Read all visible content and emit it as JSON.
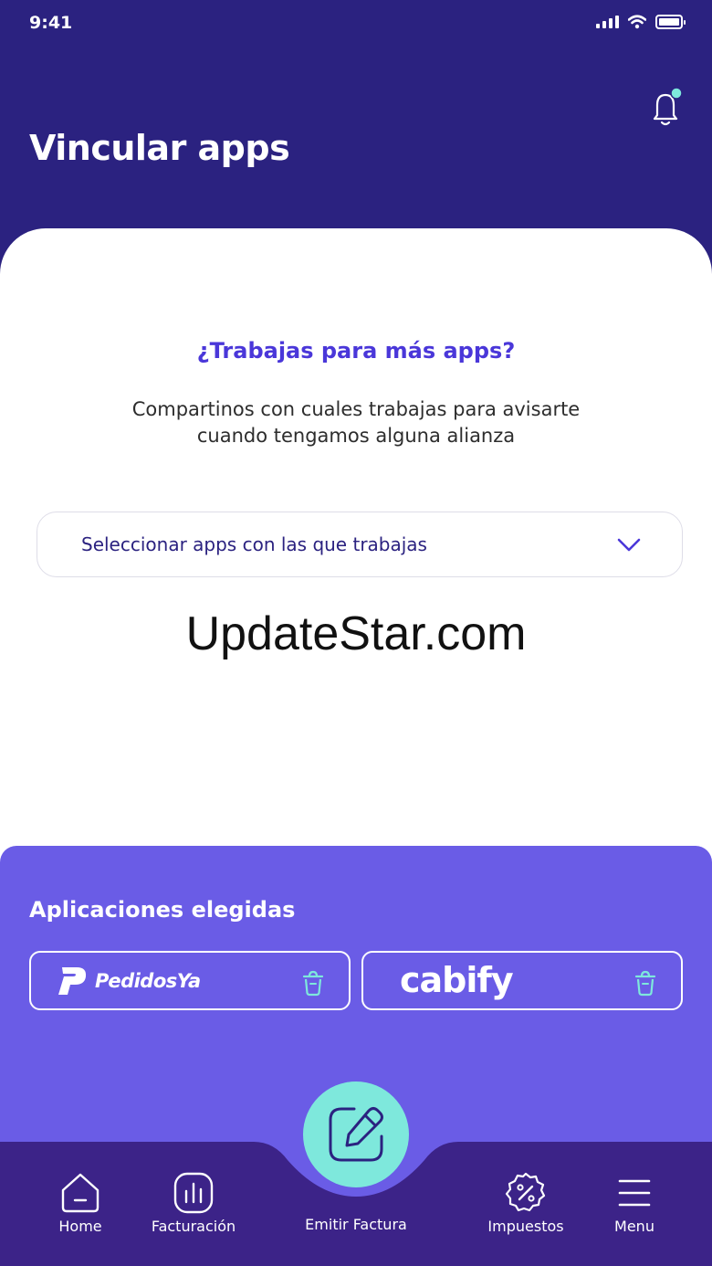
{
  "status_bar": {
    "time": "9:41"
  },
  "header": {
    "title": "Vincular apps"
  },
  "invite": {
    "question": "¿Trabajas para más apps?",
    "description": "Compartinos con cuales trabajas para avisarte cuando tengamos alguna alianza"
  },
  "select": {
    "placeholder": "Seleccionar apps con las que trabajas"
  },
  "watermark": "UpdateStar.com",
  "chosen": {
    "title": "Aplicaciones elegidas",
    "apps": [
      {
        "name": "PedidosYa",
        "logo_icon": "pedidosya-p-icon"
      },
      {
        "name": "cabify"
      }
    ]
  },
  "nav": {
    "items": [
      {
        "label": "Home",
        "icon": "home-icon"
      },
      {
        "label": "Facturación",
        "icon": "bar-chart-icon"
      },
      {
        "label": "Emitir Factura",
        "icon": "edit-icon"
      },
      {
        "label": "Impuestos",
        "icon": "percent-badge-icon"
      },
      {
        "label": "Menu",
        "icon": "hamburger-icon"
      }
    ]
  },
  "colors": {
    "header_bg": "#2b2280",
    "accent": "#4a37d9",
    "panel_bg": "#6a5ce6",
    "nav_bg": "#3c2388",
    "fab_bg": "#7ee8dc",
    "notification_dot": "#7ee8dc"
  }
}
